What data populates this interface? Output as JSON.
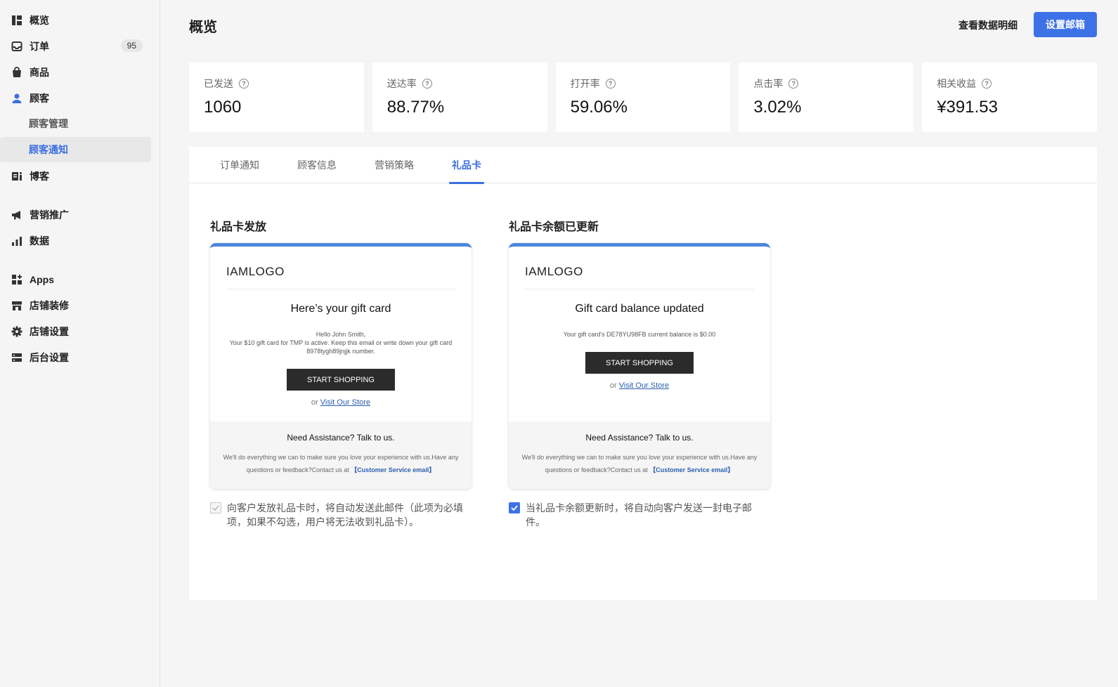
{
  "sidebar": {
    "items": [
      {
        "label": "概览",
        "icon": "dashboard-icon"
      },
      {
        "label": "订单",
        "icon": "inbox-icon",
        "badge": "95"
      },
      {
        "label": "商品",
        "icon": "shopping-bag-icon"
      },
      {
        "label": "顾客",
        "icon": "user-icon"
      },
      {
        "label": "博客",
        "icon": "blog-icon"
      },
      {
        "label": "营销推广",
        "icon": "megaphone-icon"
      },
      {
        "label": "数据",
        "icon": "bar-chart-icon"
      },
      {
        "label": "Apps",
        "icon": "apps-grid-icon"
      },
      {
        "label": "店铺装修",
        "icon": "storefront-icon"
      },
      {
        "label": "店铺设置",
        "icon": "gear-icon"
      },
      {
        "label": "后台设置",
        "icon": "server-icon"
      }
    ],
    "sub_items": [
      {
        "label": "顾客管理"
      },
      {
        "label": "顾客通知"
      }
    ],
    "accent_color": "#3a6ee0"
  },
  "header": {
    "title": "概览",
    "view_details": "查看数据明细",
    "setup_email": "设置邮箱"
  },
  "stats": [
    {
      "label": "已发送",
      "value": "1060"
    },
    {
      "label": "送达率",
      "value": "88.77%"
    },
    {
      "label": "打开率",
      "value": "59.06%"
    },
    {
      "label": "点击率",
      "value": "3.02%"
    },
    {
      "label": "相关收益",
      "value": "¥391.53"
    }
  ],
  "help_glyph": "?",
  "tabs": [
    {
      "label": "订单通知"
    },
    {
      "label": "顾客信息"
    },
    {
      "label": "营销策略"
    },
    {
      "label": "礼品卡"
    }
  ],
  "cards": [
    {
      "title": "礼品卡发放",
      "logo": "IAMLOGO",
      "heading": "Here’s your gift card",
      "body_lines": [
        "Hello John Smith,",
        "Your $10 gift card for TMP is active. Keep this email or write down your gift card 8978tygh89jnjjk number."
      ],
      "button": "START SHOPPING",
      "or_text": "or",
      "store_link": "Visit Our Store",
      "footer_title": "Need Assistance? Talk to us.",
      "footer_text": "We'll do everything we can to make sure you love your experience with us.Have any questions or feedback?Contact us at",
      "footer_link": "【Customer Service email】",
      "checkbox_label": "向客户发放礼品卡时，将自动发送此邮件（此项为必填项，如果不勾选，用户将无法收到礼品卡）。"
    },
    {
      "title": "礼品卡余额已更新",
      "logo": "IAMLOGO",
      "heading": "Gift card balance updated",
      "body_lines": [
        "Your gift card's DE78YU98FB current balance is $0.00"
      ],
      "button": "START SHOPPING",
      "or_text": "or",
      "store_link": "Visit Our Store",
      "footer_title": "Need Assistance? Talk to us.",
      "footer_text": "We'll do everything we can to make sure you love your experience with us.Have any questions or feedback?Contact us at",
      "footer_link": "【Customer Service email】",
      "checkbox_label": "当礼品卡余额更新时，将自动向客户发送一封电子邮件。"
    }
  ]
}
